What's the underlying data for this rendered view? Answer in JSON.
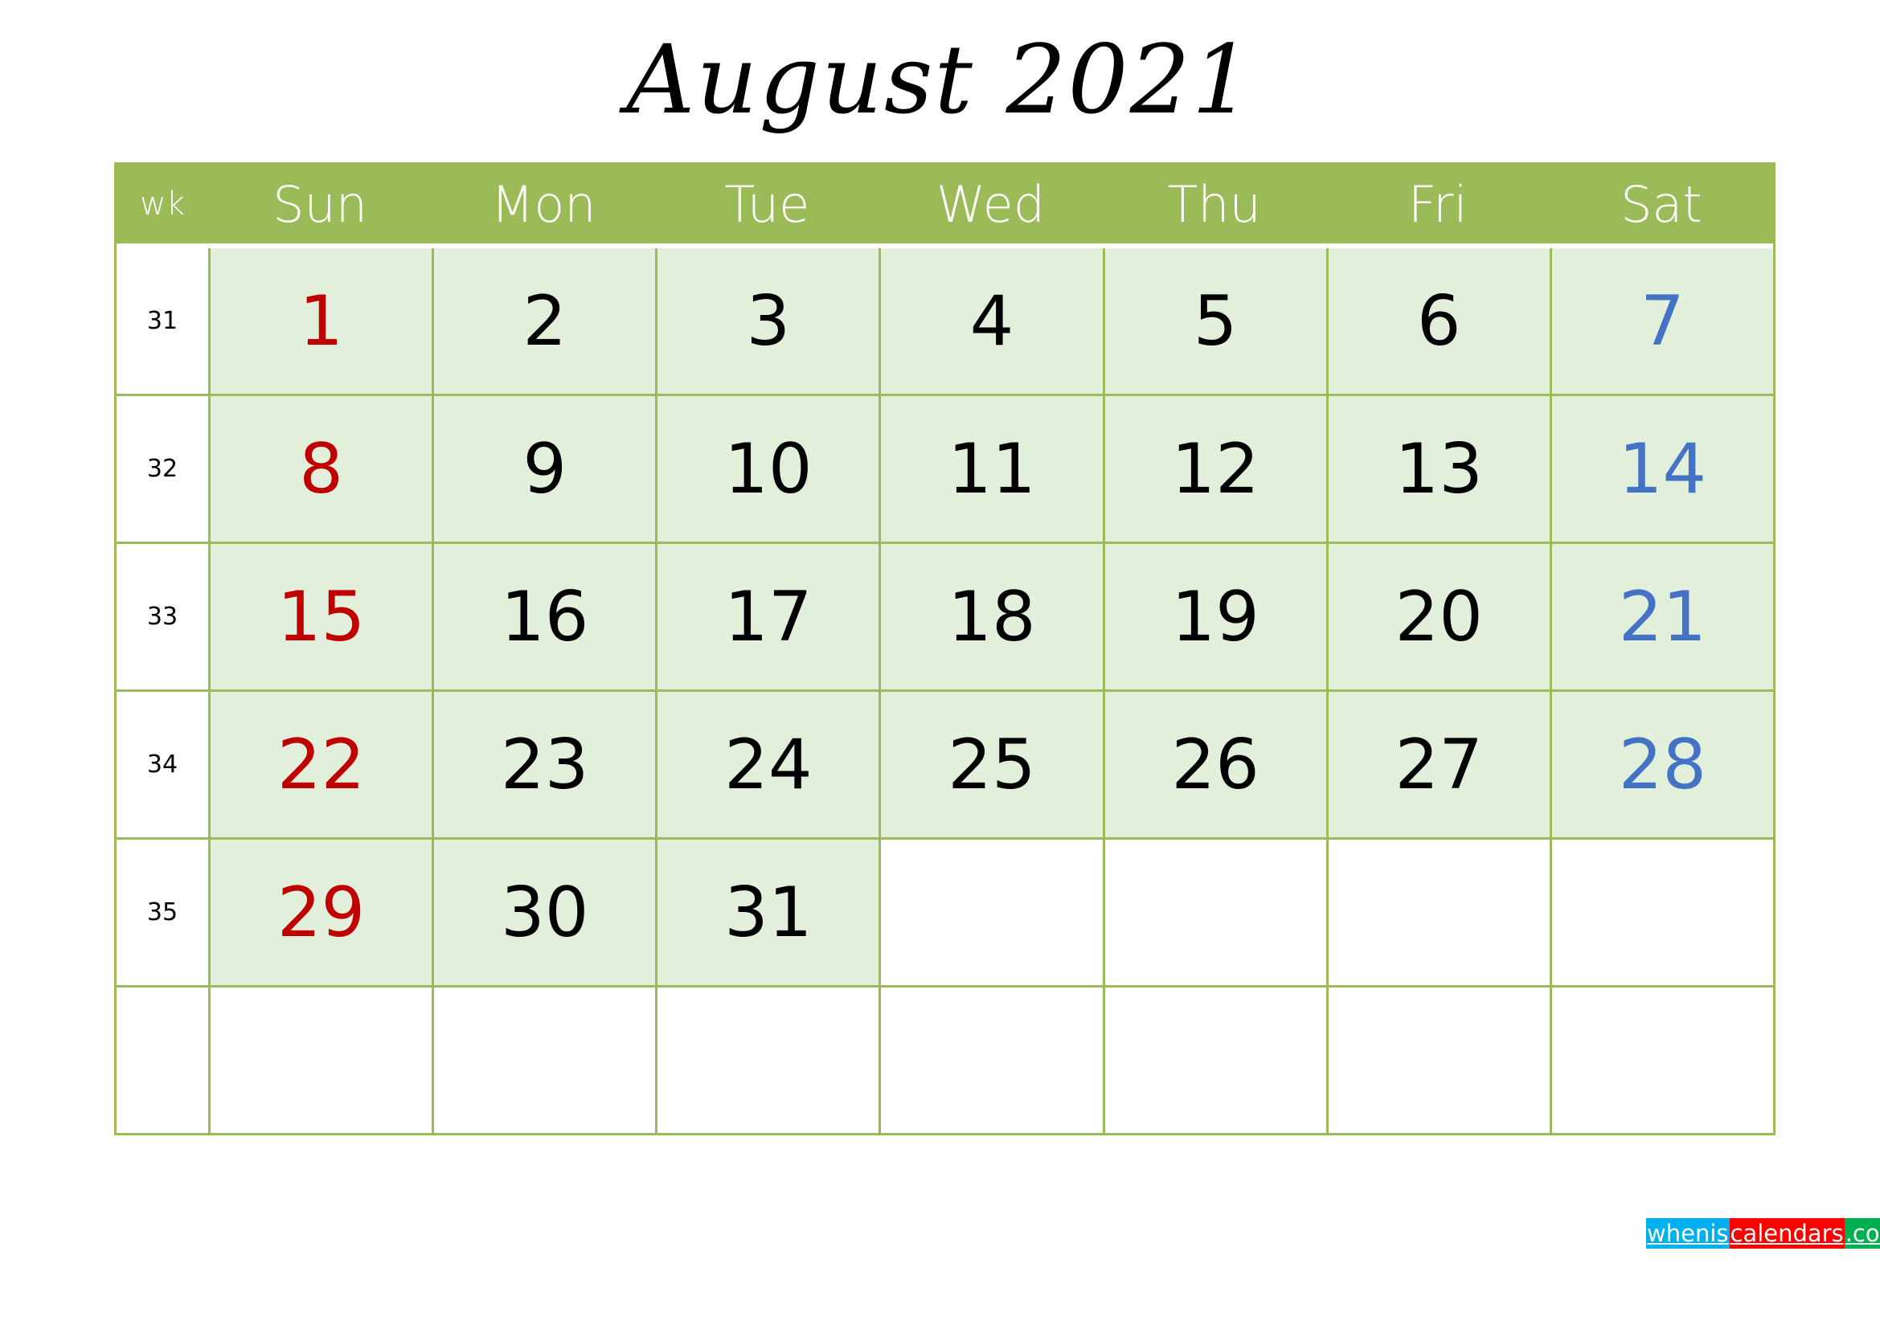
{
  "title": "August 2021",
  "header": {
    "wk": "wk",
    "days": [
      "Sun",
      "Mon",
      "Tue",
      "Wed",
      "Thu",
      "Fri",
      "Sat"
    ]
  },
  "weeks": [
    {
      "wk": "31",
      "days": [
        "1",
        "2",
        "3",
        "4",
        "5",
        "6",
        "7"
      ]
    },
    {
      "wk": "32",
      "days": [
        "8",
        "9",
        "10",
        "11",
        "12",
        "13",
        "14"
      ]
    },
    {
      "wk": "33",
      "days": [
        "15",
        "16",
        "17",
        "18",
        "19",
        "20",
        "21"
      ]
    },
    {
      "wk": "34",
      "days": [
        "22",
        "23",
        "24",
        "25",
        "26",
        "27",
        "28"
      ]
    },
    {
      "wk": "35",
      "days": [
        "29",
        "30",
        "31",
        "",
        "",
        "",
        ""
      ]
    },
    {
      "wk": "",
      "days": [
        "",
        "",
        "",
        "",
        "",
        "",
        ""
      ]
    }
  ],
  "colors": {
    "header": "#9bbb59",
    "cell_fill": "#e2efda",
    "sunday": "#c00000",
    "saturday": "#4472c4"
  },
  "logo": {
    "parts": [
      "whenis",
      "calendars",
      ".com"
    ],
    "colors": [
      "#00b0f0",
      "#ff0000",
      "#00b050"
    ]
  }
}
